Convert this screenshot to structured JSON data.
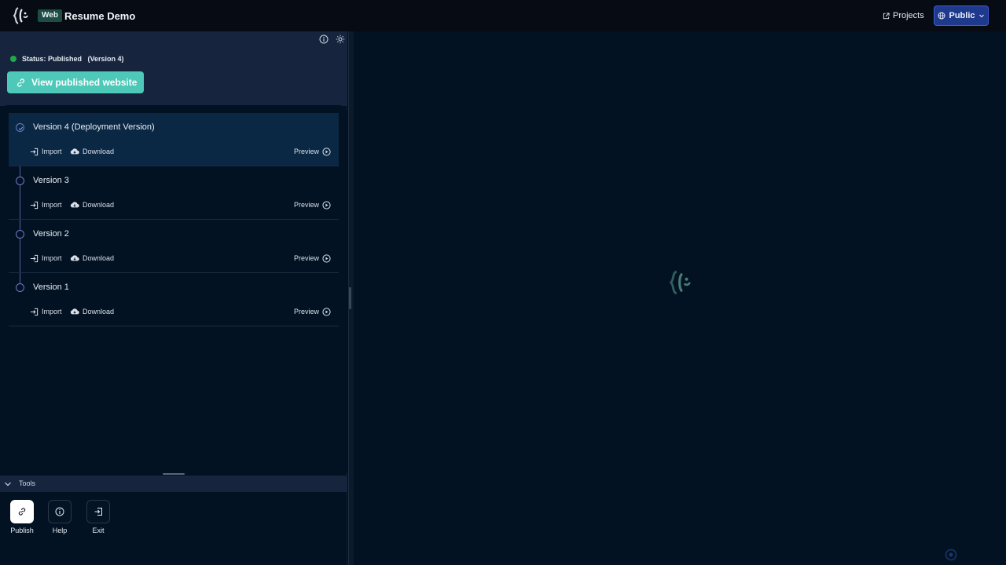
{
  "topbar": {
    "badge": "Web",
    "title": "Resume Demo",
    "projects_label": "Projects",
    "public_label": "Public"
  },
  "panel": {
    "status": "Status: Published   (Version 4)",
    "view_button": "View published website",
    "versions": [
      {
        "title": "Version 4 (Deployment Version)",
        "import": "Import",
        "download": "Download",
        "preview": "Preview"
      },
      {
        "title": "Version 3",
        "import": "Import",
        "download": "Download",
        "preview": "Preview"
      },
      {
        "title": "Version 2",
        "import": "Import",
        "download": "Download",
        "preview": "Preview"
      },
      {
        "title": "Version 1",
        "import": "Import",
        "download": "Download",
        "preview": "Preview"
      }
    ]
  },
  "tools": {
    "header": "Tools",
    "items": [
      {
        "label": "Publish",
        "icon": "link-icon"
      },
      {
        "label": "Help",
        "icon": "info-icon"
      },
      {
        "label": "Exit",
        "icon": "exit-icon"
      }
    ]
  },
  "colors": {
    "accent": "#4ec9b9",
    "public_button": "#1f3a8c",
    "status_published": "#22a84a"
  }
}
